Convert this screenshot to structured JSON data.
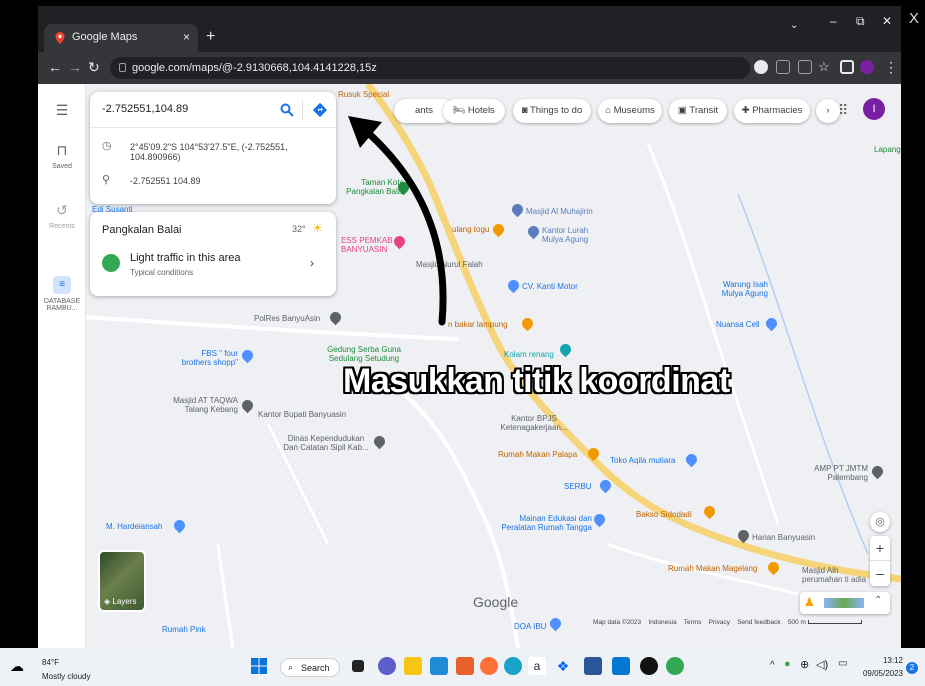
{
  "browser": {
    "tab_title": "Google Maps",
    "tab_close": "×",
    "new_tab": "+",
    "url": "google.com/maps/@-2.9130668,104.4141228,15z",
    "window_min": "–",
    "window_restore": "⧉",
    "window_close": "X"
  },
  "maps": {
    "search_value": "-2.752551,104.89",
    "suggestions": [
      {
        "icon": "clock-icon",
        "text": "2°45'09.2\"S 104°53'27.5\"E, (-2.752551, 104.890966)"
      },
      {
        "icon": "pin-icon",
        "text": "-2.752551 104.89"
      }
    ],
    "weather": {
      "place": "Pangkalan Balai",
      "temp": "32°",
      "traffic": "Light traffic in this area",
      "traffic_sub": "Typical conditions"
    },
    "rail": {
      "saved": "Saved",
      "recents": "Recents",
      "database": "DATABASE",
      "database2": "RAMBU..."
    },
    "chips": [
      "ants",
      "Hotels",
      "Things to do",
      "Museums",
      "Transit",
      "Pharmacies"
    ],
    "overlay": "Masukkan titik koordinat",
    "places": {
      "rusuk": "Rusuk Special",
      "taman1": "Taman Kota",
      "taman2": "Pangkalan Balai",
      "edi": "Edi Susanti",
      "ess1": "ESS PEMKAB",
      "ess2": "BANYUASIN",
      "masjid_muh": "Masjid Al Muhajirin",
      "kantor_lurah1": "Kantor Lurah",
      "kantor_lurah2": "Mulya Agung",
      "masjid_falah": "Masjid Nurul Falah",
      "kanti": "CV. Kanti Motor",
      "bakar": "n bakar lampung",
      "warung1": "Warung Isah",
      "warung2": "Mulya Agung",
      "nuansa": "Nuansa Cell",
      "polres": "PolRes BanyuAsin",
      "gedung1": "Gedung Serba Guna",
      "gedung2": "Sedulang Setudung",
      "kolam": "Kolam renang",
      "fbs1": "FBS \" four",
      "fbs2": "brothers shopp\"",
      "taqwa1": "Masjid AT TAQWA",
      "taqwa2": "Talang Kebang",
      "bupati": "Kantor Bupati Banyuasin",
      "bpjs1": "Kantor BPJS",
      "bpjs2": "Ketenagakerjaan...",
      "dinas1": "Dinas Kependudukan",
      "dinas2": "Dan Catatan Sipil Kab...",
      "palapa": "Rumah Makan Palapa",
      "aqila": "Toko Aqila mutiara",
      "amp1": "AMP PT JMTM",
      "amp2": "Palembang",
      "serbu": "SERBU",
      "bakso": "Bakso Sidodadi",
      "hardeiansah": "M. Hardeiansah",
      "mainan1": "Mainan Edukasi dan",
      "mainan2": "Peralatan Rumah Tangga",
      "harian": "Harian Banyuasin",
      "magelang": "Rumah Makan Magelang",
      "masjid_alh1": "Masjid Alh",
      "masjid_alh2": "perumahan ti adia",
      "lapang": "Lapang",
      "doa": "DOA IBU",
      "rumah_pink": "Rumah Pink"
    },
    "layers": "Layers",
    "google": "Google",
    "footer": {
      "mapdata": "Map data ©2023",
      "country": "Indonesia",
      "terms": "Terms",
      "privacy": "Privacy",
      "feedback": "Send feedback",
      "scale": "500 m"
    },
    "zoom_in": "+",
    "zoom_out": "–",
    "avatar": "I"
  },
  "taskbar": {
    "temp": "84°F",
    "weather": "Mostly cloudy",
    "search": "Search",
    "time": "13:12",
    "date": "09/05/2023",
    "notif": "2"
  },
  "colors": {
    "maps_blue": "#1a73e8",
    "road_yellow": "#f5d47a",
    "poi_blue": "#4d90fe",
    "poi_orange": "#f29900",
    "poi_pink": "#e8437c",
    "avatar_purple": "#7b1fa2"
  }
}
